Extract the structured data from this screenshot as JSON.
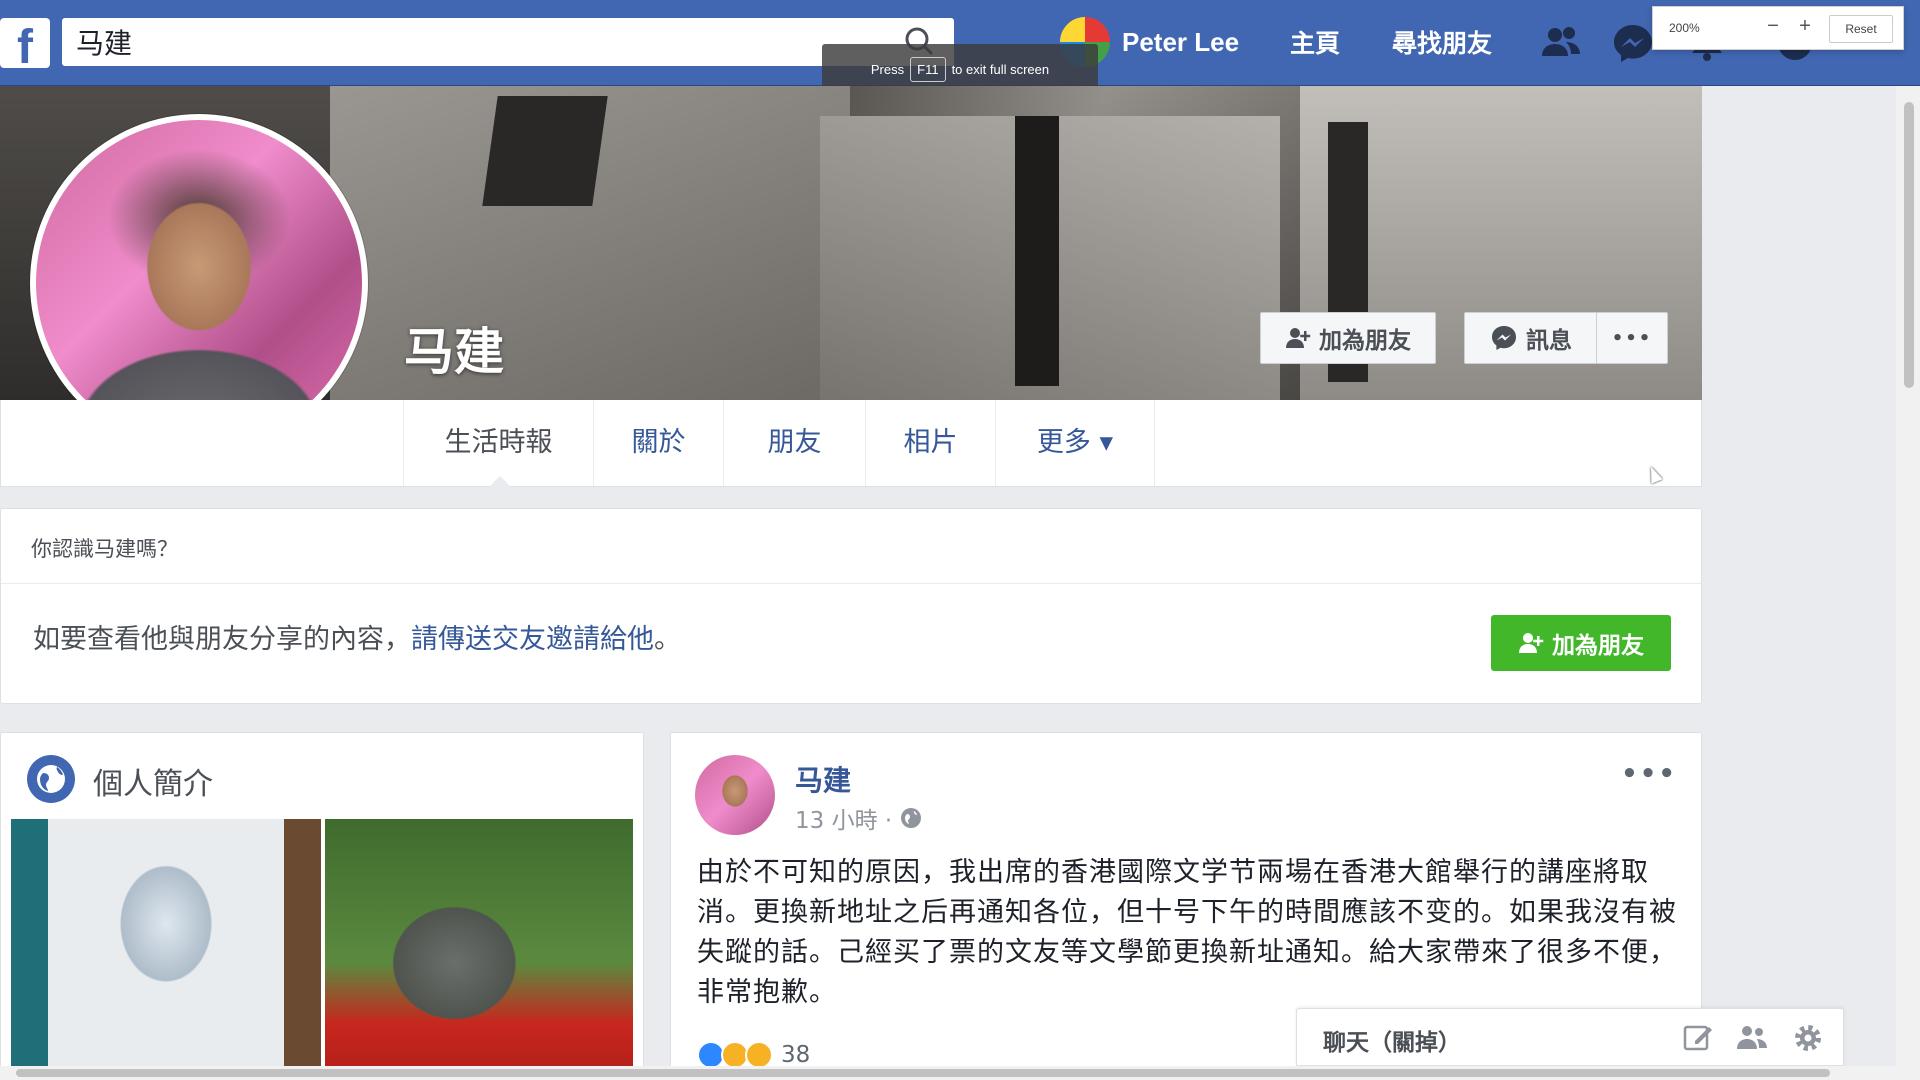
{
  "browser": {
    "fullscreen_toast": {
      "press": "Press",
      "key": "F11",
      "rest": "to exit full screen"
    },
    "zoom": {
      "percent": "200%",
      "minus": "−",
      "plus": "+",
      "reset": "Reset"
    }
  },
  "topbar": {
    "logo": "f",
    "search": {
      "value": "马建"
    },
    "user_name": "Peter Lee",
    "nav": [
      "主頁",
      "尋找朋友"
    ],
    "icons": [
      "friend-requests-icon",
      "messenger-icon",
      "notifications-icon",
      "help-icon"
    ]
  },
  "profile": {
    "name": "马建",
    "buttons": {
      "add_friend": "加為朋友",
      "message": "訊息",
      "more": "•••"
    },
    "tabs": [
      {
        "label": "生活時報",
        "active": true
      },
      {
        "label": "關於"
      },
      {
        "label": "朋友"
      },
      {
        "label": "相片"
      },
      {
        "label": "更多 ▾"
      }
    ]
  },
  "know_box": {
    "title": "你認識马建嗎？",
    "text_before": "如要查看他與朋友分享的內容，",
    "link": "請傳送交友邀請給他",
    "text_after": "。",
    "add_friend": "加為朋友"
  },
  "intro": {
    "title": "個人簡介"
  },
  "post": {
    "author": "马建",
    "time": "13 小時 ·",
    "more": "•••",
    "text": "由於不可知的原因，我出席的香港國際文学节兩場在香港大館舉行的講座將取消。更換新地址之后再通知各位，但十号下午的時間應該不变的。如果我沒有被失蹤的話。己經买了票的文友等文學節更換新址通知。給大家帶來了很多不便，非常抱歉。",
    "reaction_count": "38"
  },
  "chat": {
    "label": "聊天（關掉）"
  },
  "colors": {
    "fb_blue": "#4267b2",
    "link": "#365899",
    "green": "#42b72a"
  }
}
